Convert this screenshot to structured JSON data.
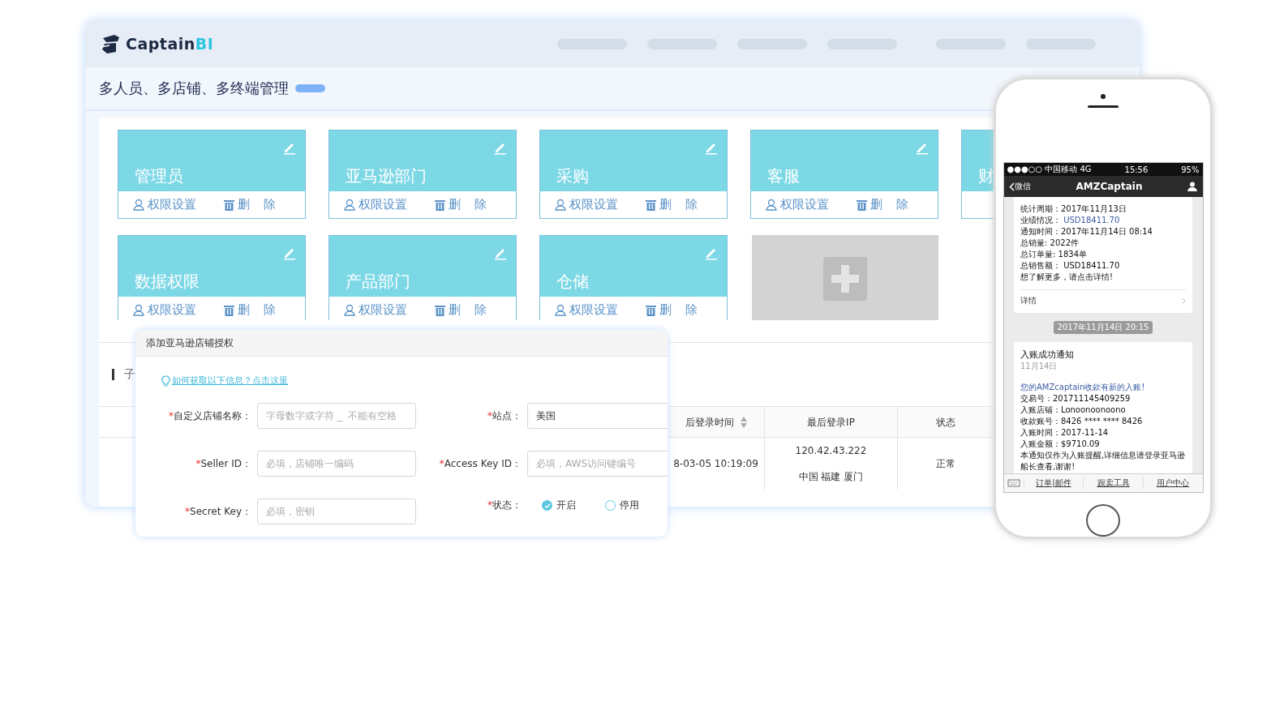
{
  "logo": {
    "name": "Captain",
    "suffix": "BI"
  },
  "page_title": "多人员、多店铺、多终端管理",
  "role_card_rows": [
    [
      {
        "title": "管理员",
        "actions": [
          "权限设置",
          "删 除"
        ]
      },
      {
        "title": "亚马逊部门",
        "actions": [
          "权限设置",
          "删 除"
        ]
      },
      {
        "title": "采购",
        "actions": [
          "权限设置",
          "删 除"
        ]
      },
      {
        "title": "客服",
        "actions": [
          "权限设置",
          "删 除"
        ]
      },
      {
        "title": "财"
      }
    ],
    [
      {
        "title": "数据权限",
        "actions": [
          "权限设置",
          "删 除"
        ]
      },
      {
        "title": "产品部门",
        "actions": [
          "权限设置",
          "删 除"
        ]
      },
      {
        "title": "仓储",
        "actions": [
          "权限设置",
          "删 除"
        ]
      }
    ]
  ],
  "section_title": "子",
  "table": {
    "columns": [
      {
        "label": "后登录时间",
        "sortable": true
      },
      {
        "label": "最后登录IP",
        "sortable": false
      },
      {
        "label": "状态",
        "sortable": false
      }
    ],
    "rows": [
      {
        "cells": [
          "8-03-05 10:19:09",
          "120.42.43.222\n中国 福建 厦门",
          "正常"
        ]
      }
    ]
  },
  "dialog": {
    "title": "添加亚马逊店铺授权",
    "required_mark": "*",
    "help_link": "如何获取以下信息？点击这里",
    "rows": [
      [
        {
          "kind": "text",
          "label": "自定义店铺名称：",
          "required": true,
          "placeholder": "字母数字或字符 _  不能有空格"
        },
        {
          "kind": "text",
          "label": "站点：",
          "required": true,
          "value": "美国"
        }
      ],
      [
        {
          "kind": "text",
          "label": "Seller ID：",
          "required": true,
          "placeholder": "必填，店铺唯一编码"
        },
        {
          "kind": "text",
          "label": "Access Key ID：",
          "required": true,
          "placeholder": "必填，AWS访问键编号"
        }
      ],
      [
        {
          "kind": "text",
          "label": "Secret Key：",
          "required": true,
          "placeholder": "必填，密钥"
        },
        {
          "kind": "radio",
          "label": "状态：",
          "required": true,
          "options": [
            {
              "label": "开启",
              "selected": true
            },
            {
              "label": "停用",
              "selected": false
            }
          ]
        }
      ]
    ]
  },
  "phone": {
    "carrier": "●●●○○ 中国移动  4G",
    "time": "15:56",
    "battery": "95%",
    "back": "微信",
    "title": "AMZCaptain",
    "messages": [
      {
        "lines": [
          {
            "text": "统计周期：2017年11月13日"
          },
          {
            "text": "业绩情况：",
            "value": "USD18411.70",
            "accent": true
          },
          {
            "text": "通知时间：2017年11月14日 08:14"
          },
          {
            "text": "总销量: 2022件"
          },
          {
            "text": "总订单量: 1834单"
          },
          {
            "text": "总销售额：",
            "value": "USD18411.70",
            "accent": false
          },
          {
            "text": "想了解更多，请点击详情!"
          }
        ],
        "footer": "详情"
      },
      {
        "timestamp": "2017年11月14日 20:15",
        "title": "入账成功通知",
        "date": "11月14日",
        "lines": [
          {
            "text": "您的AMZcaptain收款有新的入账!",
            "accent": true
          },
          {
            "text": "交易号：201711145409259"
          },
          {
            "text": "入账店铺：Lonoonoonoono"
          },
          {
            "text": "收款账号：8426 **** **** 8426"
          },
          {
            "text": "入账时间：2017-11-14"
          },
          {
            "text": "入账金额：$9710.09"
          },
          {
            "text": "本通知仅作为入账提醒,详细信息请登录亚马逊船长查看,谢谢!"
          }
        ]
      }
    ],
    "menu": [
      "订单|邮件",
      "跟卖工具",
      "用户中心"
    ]
  }
}
